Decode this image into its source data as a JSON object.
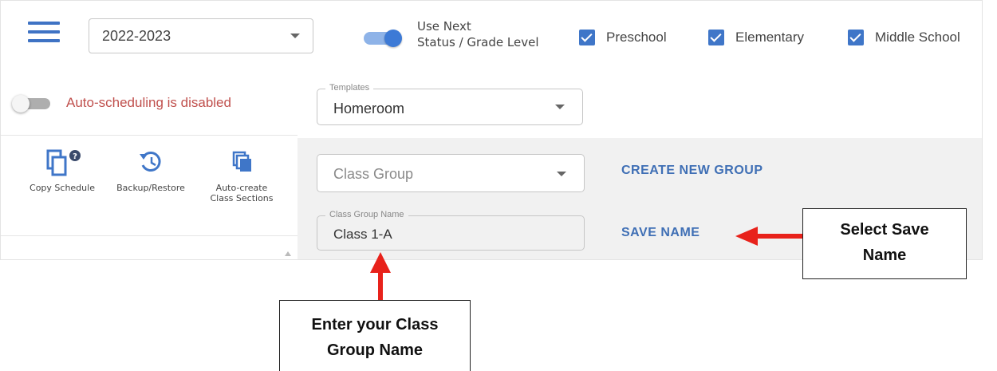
{
  "header": {
    "school_year": "2022-2023",
    "use_next_line1": "Use Next",
    "use_next_line2": "Status / Grade Level",
    "levels": [
      "Preschool",
      "Elementary",
      "Middle School"
    ]
  },
  "sidebar": {
    "auto_scheduling": "Auto-scheduling is disabled",
    "tools": [
      {
        "label_line1": "Copy Schedule",
        "label_line2": ""
      },
      {
        "label_line1": "Backup/Restore",
        "label_line2": ""
      },
      {
        "label_line1": "Auto-create",
        "label_line2": "Class Sections"
      }
    ]
  },
  "main": {
    "templates_legend": "Templates",
    "templates_value": "Homeroom",
    "class_group_value": "Class Group",
    "create_new_group": "CREATE NEW GROUP",
    "class_group_name_legend": "Class Group Name",
    "class_group_name_value": "Class 1-A",
    "save_name": "SAVE NAME"
  },
  "annotations": {
    "save_name_line1": "Select Save",
    "save_name_line2": "Name",
    "group_name_line1": "Enter your Class",
    "group_name_line2": "Group Name"
  },
  "colors": {
    "accent": "#3f76c8",
    "disabled_text": "#c0504d",
    "arrow": "#e8221b"
  }
}
